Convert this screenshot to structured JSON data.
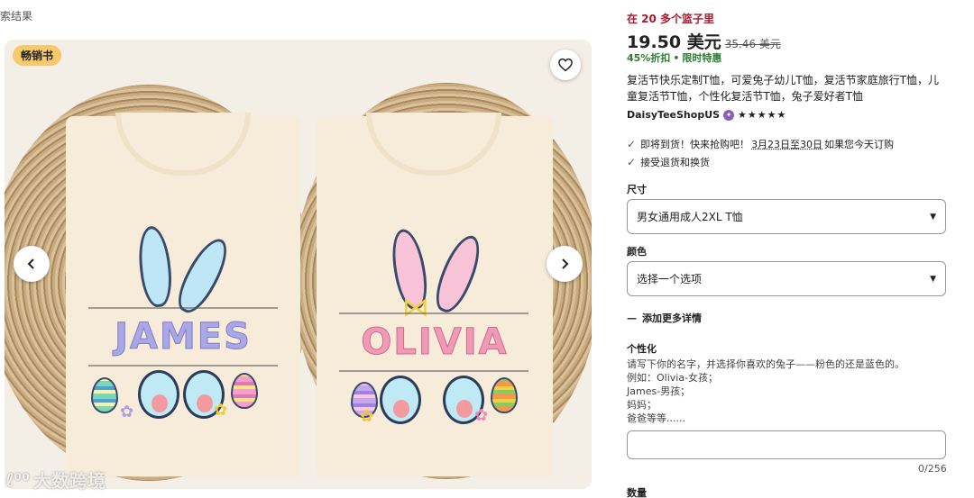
{
  "breadcrumb": "索结果",
  "gallery": {
    "badge": "畅销书",
    "shirt_left_name": "JAMES",
    "shirt_right_name": "OLIVIA",
    "watermark": "大数跨境",
    "prev_icon": "chevron-left-icon",
    "next_icon": "chevron-right-icon",
    "favorite_icon": "heart-icon"
  },
  "product": {
    "stock_note": "在 20 多个篮子里",
    "price": "19.50 美元",
    "original_price": "35.46 美元",
    "discount": "45%折扣",
    "deal": "限时特惠",
    "title": "复活节快乐定制T恤，可爱兔子幼儿T恤，复活节家庭旅行T恤，儿童复活节T恤，个性化复活节T恤，兔子爱好者T恤",
    "shop_name": "DaisyTeeShopUS",
    "rating_stars": "★★★★★",
    "delivery_prefix": "即将到货！快来抢购吧！",
    "delivery_dates": "3月23日至30日",
    "delivery_suffix": "如果您今天订购",
    "returns": "接受退货和换货"
  },
  "options": {
    "size_label": "尺寸",
    "size_value": "男女通用成人2XL T恤",
    "color_label": "颜色",
    "color_value": "选择一个选项",
    "more_details": "添加更多详情"
  },
  "personalization": {
    "label": "个性化",
    "instructions": [
      "请写下你的名字，并选择你喜欢的兔子——粉色的还是蓝色的。",
      "例如：Olivia-女孩；",
      "James-男孩；",
      "妈妈；",
      "爸爸等等......"
    ],
    "counter": "0/256"
  },
  "quantity_label": "数量",
  "colors": {
    "stock_red": "#a61a2e",
    "discount_green": "#2e7d32",
    "badge_yellow": "#f6c96a",
    "james_purple": "#a9a7e6",
    "olivia_pink": "#f19ab5"
  }
}
